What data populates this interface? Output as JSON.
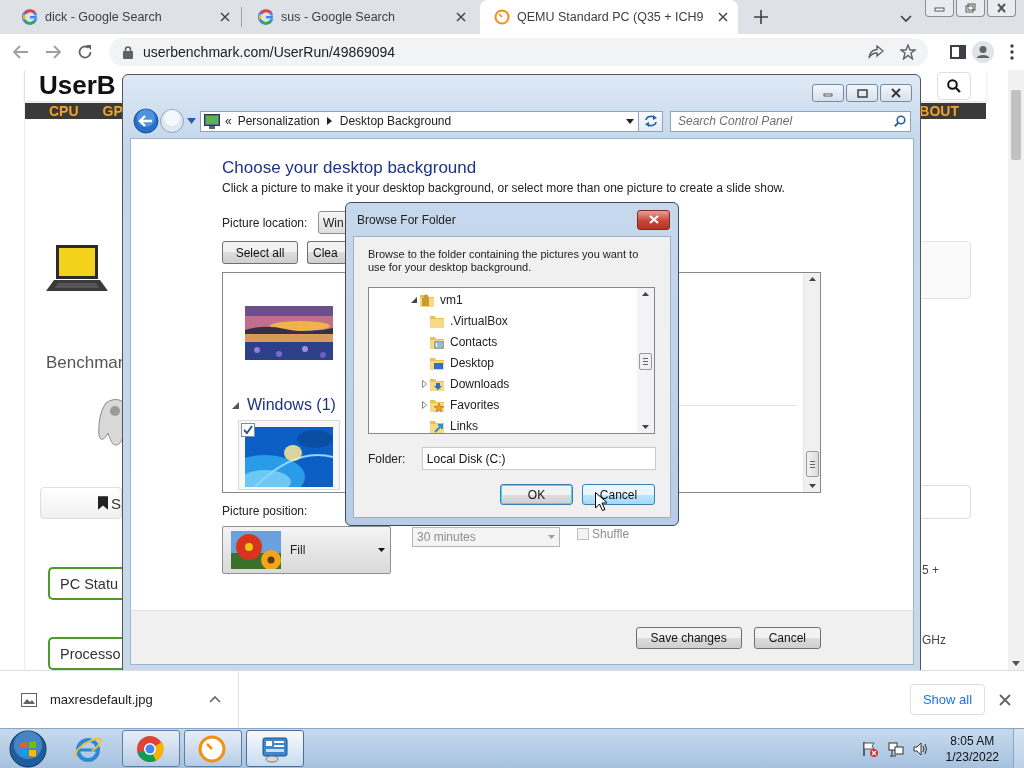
{
  "browser": {
    "tabs": [
      {
        "kind": "google",
        "title": "dick - Google Search",
        "selected": false
      },
      {
        "kind": "google",
        "title": "sus - Google Search",
        "selected": false
      },
      {
        "kind": "clock",
        "title": "QEMU Standard PC (Q35 + ICH9",
        "selected": true
      }
    ],
    "url": "userbenchmark.com/UserRun/49869094"
  },
  "webpage": {
    "logo": "UserB",
    "nav": [
      "CPU",
      "GP"
    ],
    "nav_end": "BOUT",
    "heading": "Benchmar",
    "save_button": "S",
    "status_button": "PC Statu",
    "processor_button": "Processo",
    "right_texts": [
      "5 +",
      "GHz"
    ]
  },
  "control_panel": {
    "overflow_mark": "«",
    "breadcrumb": [
      "Personalization",
      "Desktop Background"
    ],
    "search_placeholder": "Search Control Panel",
    "heading": "Choose your desktop background",
    "description": "Click a picture to make it your desktop background, or select more than one picture to create a slide show.",
    "location_label": "Picture location:",
    "location_value": "Win",
    "buttons": [
      "Select all",
      "Clea"
    ],
    "thumbnails": [
      {
        "kind": "picture",
        "checked": false
      }
    ],
    "groups": [
      {
        "title": "Windows (1)",
        "expanded": true,
        "thumbnails": [
          {
            "kind": "picture",
            "checked": true
          }
        ]
      }
    ],
    "position_label": "Picture position:",
    "position_value": "Fill",
    "interval": {
      "value": "30 minutes",
      "disabled": true
    },
    "shuffle": {
      "label": "Shuffle",
      "checked": false,
      "disabled": true
    },
    "footer_buttons": [
      "Save changes",
      "Cancel"
    ]
  },
  "browse_dialog": {
    "title": "Browse For Folder",
    "instructions": "Browse to the folder containing the pictures you want to use for your desktop background.",
    "tree": [
      {
        "label": "vm1",
        "kind": "user",
        "expandable": true,
        "expanded": true,
        "children": [
          {
            "label": ".VirtualBox",
            "kind": "folder",
            "expandable": false
          },
          {
            "label": "Contacts",
            "kind": "contacts",
            "expandable": false
          },
          {
            "label": "Desktop",
            "kind": "desktop",
            "expandable": false
          },
          {
            "label": "Downloads",
            "kind": "downloads",
            "expandable": true,
            "expanded": false
          },
          {
            "label": "Favorites",
            "kind": "favorites",
            "expandable": true,
            "expanded": false
          },
          {
            "label": "Links",
            "kind": "links",
            "expandable": false
          }
        ]
      }
    ],
    "folder_label": "Folder:",
    "folder_value": "Local Disk (C:)",
    "buttons": [
      {
        "label": "OK",
        "focused": true,
        "hovered": false
      },
      {
        "label": "Cancel",
        "focused": false,
        "hovered": true
      }
    ]
  },
  "downloads": {
    "file": "maxresdefault.jpg",
    "show_all": "Show all"
  },
  "taskbar": {
    "items": [
      {
        "kind": "ie",
        "running": false,
        "active": false
      },
      {
        "kind": "chrome",
        "running": true,
        "active": false
      },
      {
        "kind": "clock",
        "running": true,
        "active": false
      },
      {
        "kind": "control-panel",
        "running": true,
        "active": true
      }
    ],
    "time": "8:05 AM",
    "date": "1/23/2022"
  }
}
